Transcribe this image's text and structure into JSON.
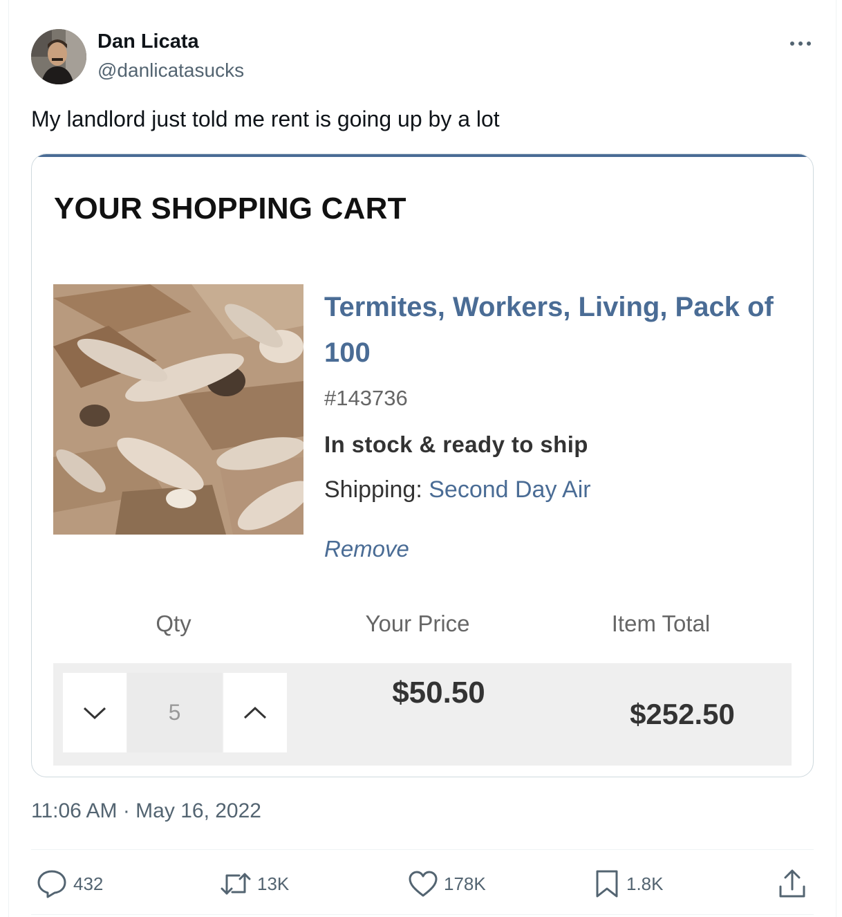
{
  "author": {
    "name": "Dan Licata",
    "handle": "@danlicatasucks"
  },
  "tweet": {
    "text": "My landlord just told me rent is going up by a lot",
    "timestamp": "11:06 AM · May 16, 2022"
  },
  "cart": {
    "title": "YOUR SHOPPING CART",
    "product": {
      "name": "Termites, Workers, Living, Pack of 100",
      "sku": "#143736",
      "stock": "In stock & ready to ship",
      "shipping_label": "Shipping: ",
      "shipping_method": "Second Day Air",
      "remove_label": "Remove"
    },
    "columns": {
      "qty": "Qty",
      "price": "Your Price",
      "total": "Item Total"
    },
    "quantity": "5",
    "price": "$50.50",
    "item_total": "$252.50"
  },
  "actions": {
    "replies": "432",
    "reposts": "13K",
    "likes": "178K",
    "bookmarks": "1.8K"
  },
  "colors": {
    "link": "#4a6c95",
    "secondary_text": "#536471"
  }
}
